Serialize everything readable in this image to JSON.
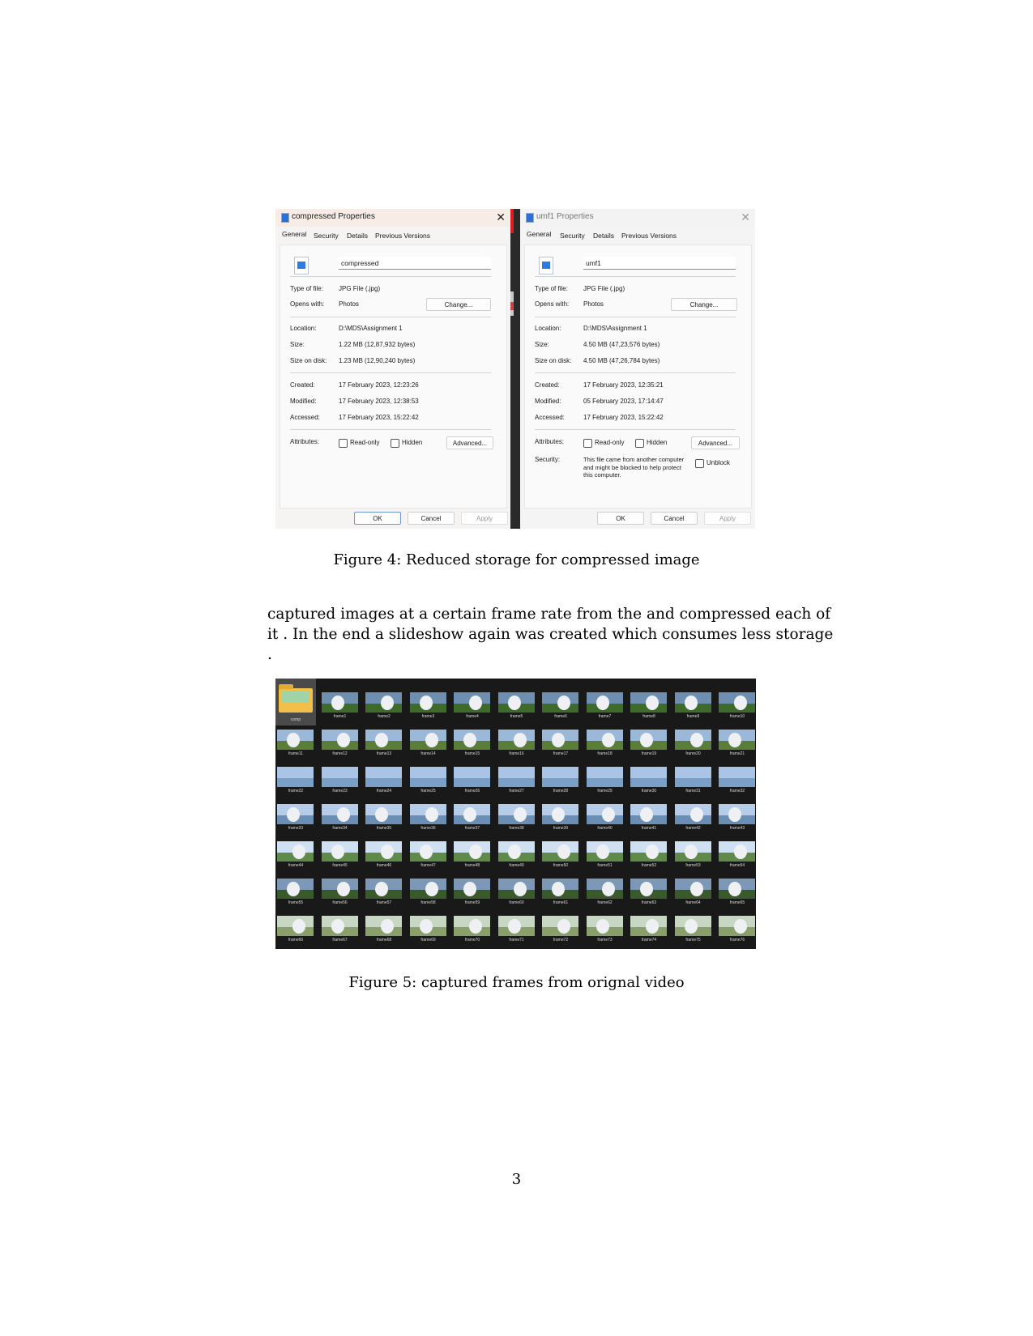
{
  "figure4": {
    "caption": "Figure 4: Reduced storage for compressed image",
    "tabs": [
      "General",
      "Security",
      "Details",
      "Previous Versions"
    ],
    "labels": {
      "type": "Type of file:",
      "opens": "Opens with:",
      "location": "Location:",
      "size": "Size:",
      "size_disk": "Size on disk:",
      "created": "Created:",
      "modified": "Modified:",
      "accessed": "Accessed:",
      "attributes": "Attributes:",
      "security": "Security:",
      "readonly": "Read-only",
      "hidden": "Hidden",
      "unblock": "Unblock"
    },
    "buttons": {
      "change": "Change...",
      "advanced": "Advanced...",
      "ok": "OK",
      "cancel": "Cancel",
      "apply": "Apply"
    },
    "left": {
      "title": "compressed Properties",
      "name": "compressed",
      "type": "JPG File (.jpg)",
      "opens": "Photos",
      "location": "D:\\MDS\\Assignment 1",
      "size": "1.22 MB (12,87,932 bytes)",
      "size_disk": "1.23 MB (12,90,240 bytes)",
      "created": "17 February 2023, 12:23:26",
      "modified": "17 February 2023, 12:38:53",
      "accessed": "17 February 2023, 15:22:42"
    },
    "right": {
      "title": "umf1 Properties",
      "name": "umf1",
      "type": "JPG File (.jpg)",
      "opens": "Photos",
      "location": "D:\\MDS\\Assignment 1",
      "size": "4.50 MB (47,23,576 bytes)",
      "size_disk": "4.50 MB (47,26,784 bytes)",
      "created": "17 February 2023, 12:35:21",
      "modified": "05 February 2023, 17:14:47",
      "accessed": "17 February 2023, 15:22:42",
      "security_text": "This file came from another computer and might be blocked to help protect this computer."
    }
  },
  "body": {
    "lines": [
      "captured images at a certain frame rate from the and compressed each of",
      "it . In the end a slideshow again was created which consumes less storage",
      "."
    ]
  },
  "figure5": {
    "caption": "Figure 5: captured frames from orignal video",
    "folder_label": "comp",
    "frames": [
      "frame1",
      "frame2",
      "frame3",
      "frame4",
      "frame5",
      "frame6",
      "frame7",
      "frame8",
      "frame9",
      "frame10",
      "frame11",
      "frame12",
      "frame13",
      "frame14",
      "frame15",
      "frame16",
      "frame17",
      "frame18",
      "frame19",
      "frame20",
      "frame21",
      "frame22",
      "frame23",
      "frame24",
      "frame25",
      "frame26",
      "frame27",
      "frame28",
      "frame29",
      "frame30",
      "frame31",
      "frame32",
      "frame33",
      "frame34",
      "frame35",
      "frame36",
      "frame37",
      "frame38",
      "frame39",
      "frame40",
      "frame41",
      "frame42",
      "frame43",
      "frame44",
      "frame45",
      "frame46",
      "frame47",
      "frame48",
      "frame49",
      "frame50",
      "frame51",
      "frame52",
      "frame53",
      "frame54",
      "frame55",
      "frame56",
      "frame57",
      "frame58",
      "frame59",
      "frame60",
      "frame61",
      "frame62",
      "frame63",
      "frame64",
      "frame65",
      "frame66",
      "frame67",
      "frame68",
      "frame69",
      "frame70",
      "frame71",
      "frame72",
      "frame73",
      "frame74",
      "frame75",
      "frame76"
    ]
  },
  "page_number": "3"
}
